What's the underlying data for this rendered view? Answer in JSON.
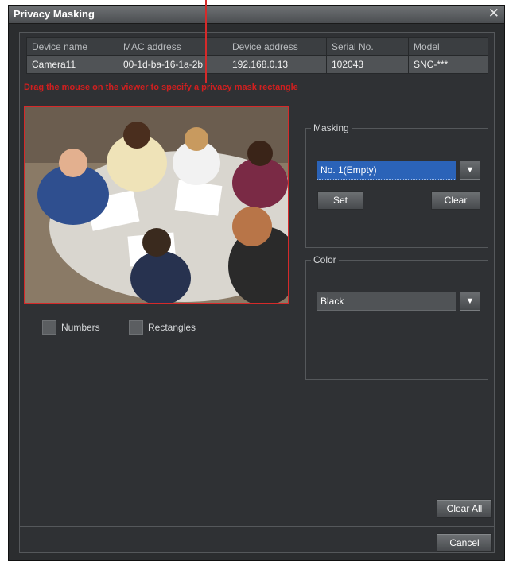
{
  "window": {
    "title": "Privacy Masking"
  },
  "device_table": {
    "headers": [
      "Device name",
      "MAC address",
      "Device address",
      "Serial No.",
      "Model"
    ],
    "row": [
      "Camera11",
      "00-1d-ba-16-1a-2b",
      "192.168.0.13",
      "102043",
      "SNC-***"
    ]
  },
  "instruction": "Drag the mouse on the viewer to specify a privacy mask rectangle",
  "options": {
    "numbers_label": "Numbers",
    "rectangles_label": "Rectangles"
  },
  "masking": {
    "legend": "Masking",
    "selected": "No. 1(Empty)",
    "set_label": "Set",
    "clear_label": "Clear"
  },
  "color": {
    "legend": "Color",
    "selected": "Black"
  },
  "footer": {
    "clear_all_label": "Clear All",
    "cancel_label": "Cancel"
  },
  "icons": {
    "close": "close-icon",
    "dropdown": "chevron-down-icon"
  },
  "colors": {
    "accent_red": "#d52a2a",
    "selection_blue": "#2b63b8",
    "panel_bg": "#2f3134"
  }
}
